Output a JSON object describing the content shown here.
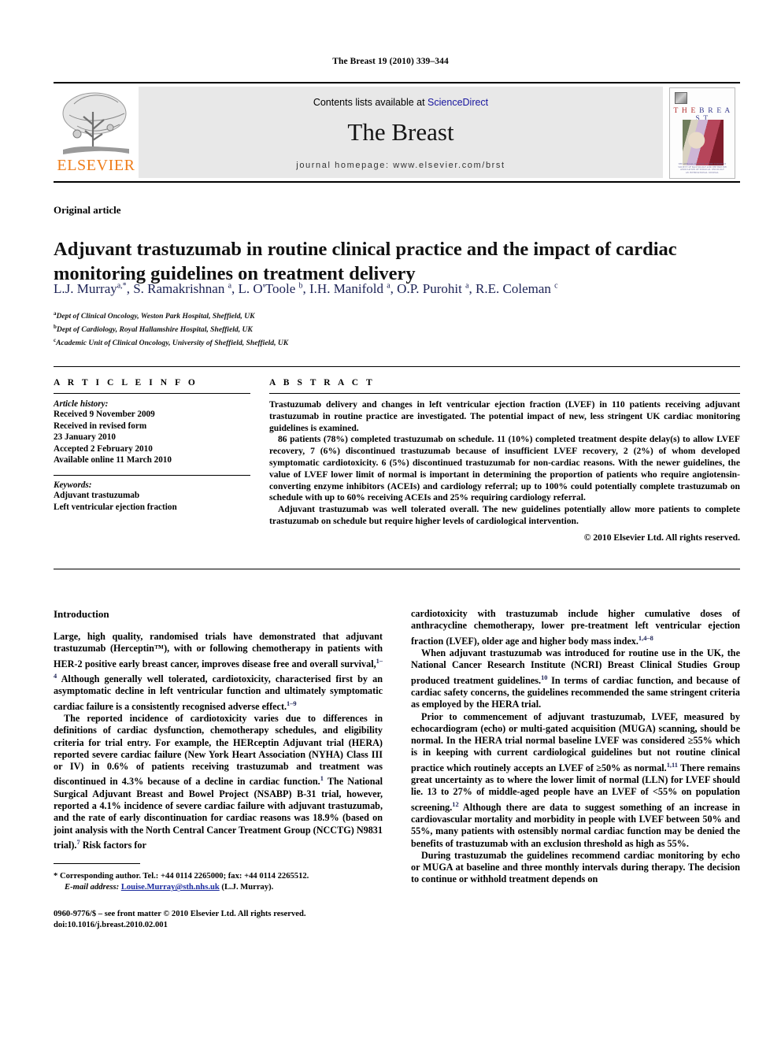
{
  "running_head": "The Breast 19 (2010) 339–344",
  "masthead": {
    "publisher_name": "ELSEVIER",
    "contents_prefix": "Contents lists available at ",
    "contents_link": "ScienceDirect",
    "journal_title": "The Breast",
    "homepage": "journal homepage: www.elsevier.com/brst",
    "cover": {
      "title_part1": "T H E",
      "title_part2": "B R E A S T",
      "footer_line1": "THE OFFICIAL JOURNAL OF THE EUROPEAN",
      "footer_line2": "SOCIETY OF MASTOLOGY AND THE BRITISH",
      "footer_line3": "ASSOCIATION OF SURGICAL ONCOLOGY",
      "footer_line4": "AN INTERNATIONAL JOURNAL"
    },
    "link_color": "#17159e",
    "brand_color": "#ef7d1a"
  },
  "article": {
    "type": "Original article",
    "title": "Adjuvant trastuzumab in routine clinical practice and the impact of cardiac monitoring guidelines on treatment delivery",
    "authors_html": "L.J. Murray<sup>a,*</sup>, S. Ramakrishnan <sup>a</sup>, L. O'Toole <sup>b</sup>, I.H. Manifold <sup>a</sup>, O.P. Purohit <sup>a</sup>, R.E. Coleman <sup>c</sup>",
    "affiliations": [
      {
        "marker": "a",
        "text": "Dept of Clinical Oncology, Weston Park Hospital, Sheffield, UK"
      },
      {
        "marker": "b",
        "text": "Dept of Cardiology, Royal Hallamshire Hospital, Sheffield, UK"
      },
      {
        "marker": "c",
        "text": "Academic Unit of Clinical Oncology, University of Sheffield, Sheffield, UK"
      }
    ]
  },
  "article_info": {
    "heading": "A R T I C L E   I N F O",
    "history_label": "Article history:",
    "history": [
      "Received 9 November 2009",
      "Received in revised form",
      "23 January 2010",
      "Accepted 2 February 2010",
      "Available online 11 March 2010"
    ],
    "keywords_label": "Keywords:",
    "keywords": [
      "Adjuvant trastuzumab",
      "Left ventricular ejection fraction"
    ]
  },
  "abstract": {
    "heading": "A B S T R A C T",
    "paragraphs": [
      "Trastuzumab delivery and changes in left ventricular ejection fraction (LVEF) in 110 patients receiving adjuvant trastuzumab in routine practice are investigated. The potential impact of new, less stringent UK cardiac monitoring guidelines is examined.",
      "86 patients (78%) completed trastuzumab on schedule. 11 (10%) completed treatment despite delay(s) to allow LVEF recovery, 7 (6%) discontinued trastuzumab because of insufficient LVEF recovery, 2 (2%) of whom developed symptomatic cardiotoxicity. 6 (5%) discontinued trastuzumab for non-cardiac reasons. With the newer guidelines, the value of LVEF lower limit of normal is important in determining the proportion of patients who require angiotensin-converting enzyme inhibitors (ACEIs) and cardiology referral; up to 100% could potentially complete trastuzumab on schedule with up to 60% receiving ACEIs and 25% requiring cardiology referral.",
      "Adjuvant trastuzumab was well tolerated overall. The new guidelines potentially allow more patients to complete trastuzumab on schedule but require higher levels of cardiological intervention."
    ],
    "copyright": "© 2010 Elsevier Ltd. All rights reserved."
  },
  "body": {
    "intro_heading": "Introduction",
    "left_paragraphs": [
      "Large, high quality, randomised trials have demonstrated that adjuvant trastuzumab (Herceptin™), with or following chemotherapy in patients with HER-2 positive early breast cancer, improves disease free and overall survival,<sup>1–4</sup> Although generally well tolerated, cardiotoxicity, characterised first by an asymptomatic decline in left ventricular function and ultimately symptomatic cardiac failure is a consistently recognised adverse effect.<sup>1–9</sup>",
      "The reported incidence of cardiotoxicity varies due to differences in definitions of cardiac dysfunction, chemotherapy schedules, and eligibility criteria for trial entry. For example, the HERceptin Adjuvant trial (HERA) reported severe cardiac failure (New York Heart Association (NYHA) Class III or IV) in 0.6% of patients receiving trastuzumab and treatment was discontinued in 4.3% because of a decline in cardiac function.<sup>1</sup> The National Surgical Adjuvant Breast and Bowel Project (NSABP) B-31 trial, however, reported a 4.1% incidence of severe cardiac failure with adjuvant trastuzumab, and the rate of early discontinuation for cardiac reasons was 18.9% (based on joint analysis with the North Central Cancer Treatment Group (NCCTG) N9831 trial).<sup>7</sup> Risk factors for"
    ],
    "right_paragraphs": [
      "cardiotoxicity with trastuzumab include higher cumulative doses of anthracycline chemotherapy, lower pre-treatment left ventricular ejection fraction (LVEF), older age and higher body mass index.<sup>1,4–8</sup>",
      "When adjuvant trastuzumab was introduced for routine use in the UK, the National Cancer Research Institute (NCRI) Breast Clinical Studies Group produced treatment guidelines.<sup>10</sup> In terms of cardiac function, and because of cardiac safety concerns, the guidelines recommended the same stringent criteria as employed by the HERA trial.",
      "Prior to commencement of adjuvant trastuzumab, LVEF, measured by echocardiogram (echo) or multi-gated acquisition (MUGA) scanning, should be normal. In the HERA trial normal baseline LVEF was considered ≥55% which is in keeping with current cardiological guidelines but not routine clinical practice which routinely accepts an LVEF of ≥50% as normal.<sup>1,11</sup> There remains great uncertainty as to where the lower limit of normal (LLN) for LVEF should lie. 13 to 27% of middle-aged people have an LVEF of &lt;55% on population screening.<sup>12</sup> Although there are data to suggest something of an increase in cardiovascular mortality and morbidity in people with LVEF between 50% and 55%, many patients with ostensibly normal cardiac function may be denied the benefits of trastuzumab with an exclusion threshold as high as 55%.",
      "During trastuzumab the guidelines recommend cardiac monitoring by echo or MUGA at baseline and three monthly intervals during therapy. The decision to continue or withhold treatment depends on"
    ]
  },
  "footnote": {
    "corresponding": "* Corresponding author. Tel.: +44 0114 2265000; fax: +44 0114 2265512.",
    "email_label": "E-mail address:",
    "email": "Louise.Murray@sth.nhs.uk",
    "email_suffix": " (L.J. Murray)."
  },
  "imprint": {
    "line1": "0960-9776/$ – see front matter © 2010 Elsevier Ltd. All rights reserved.",
    "line2": "doi:10.1016/j.breast.2010.02.001"
  }
}
